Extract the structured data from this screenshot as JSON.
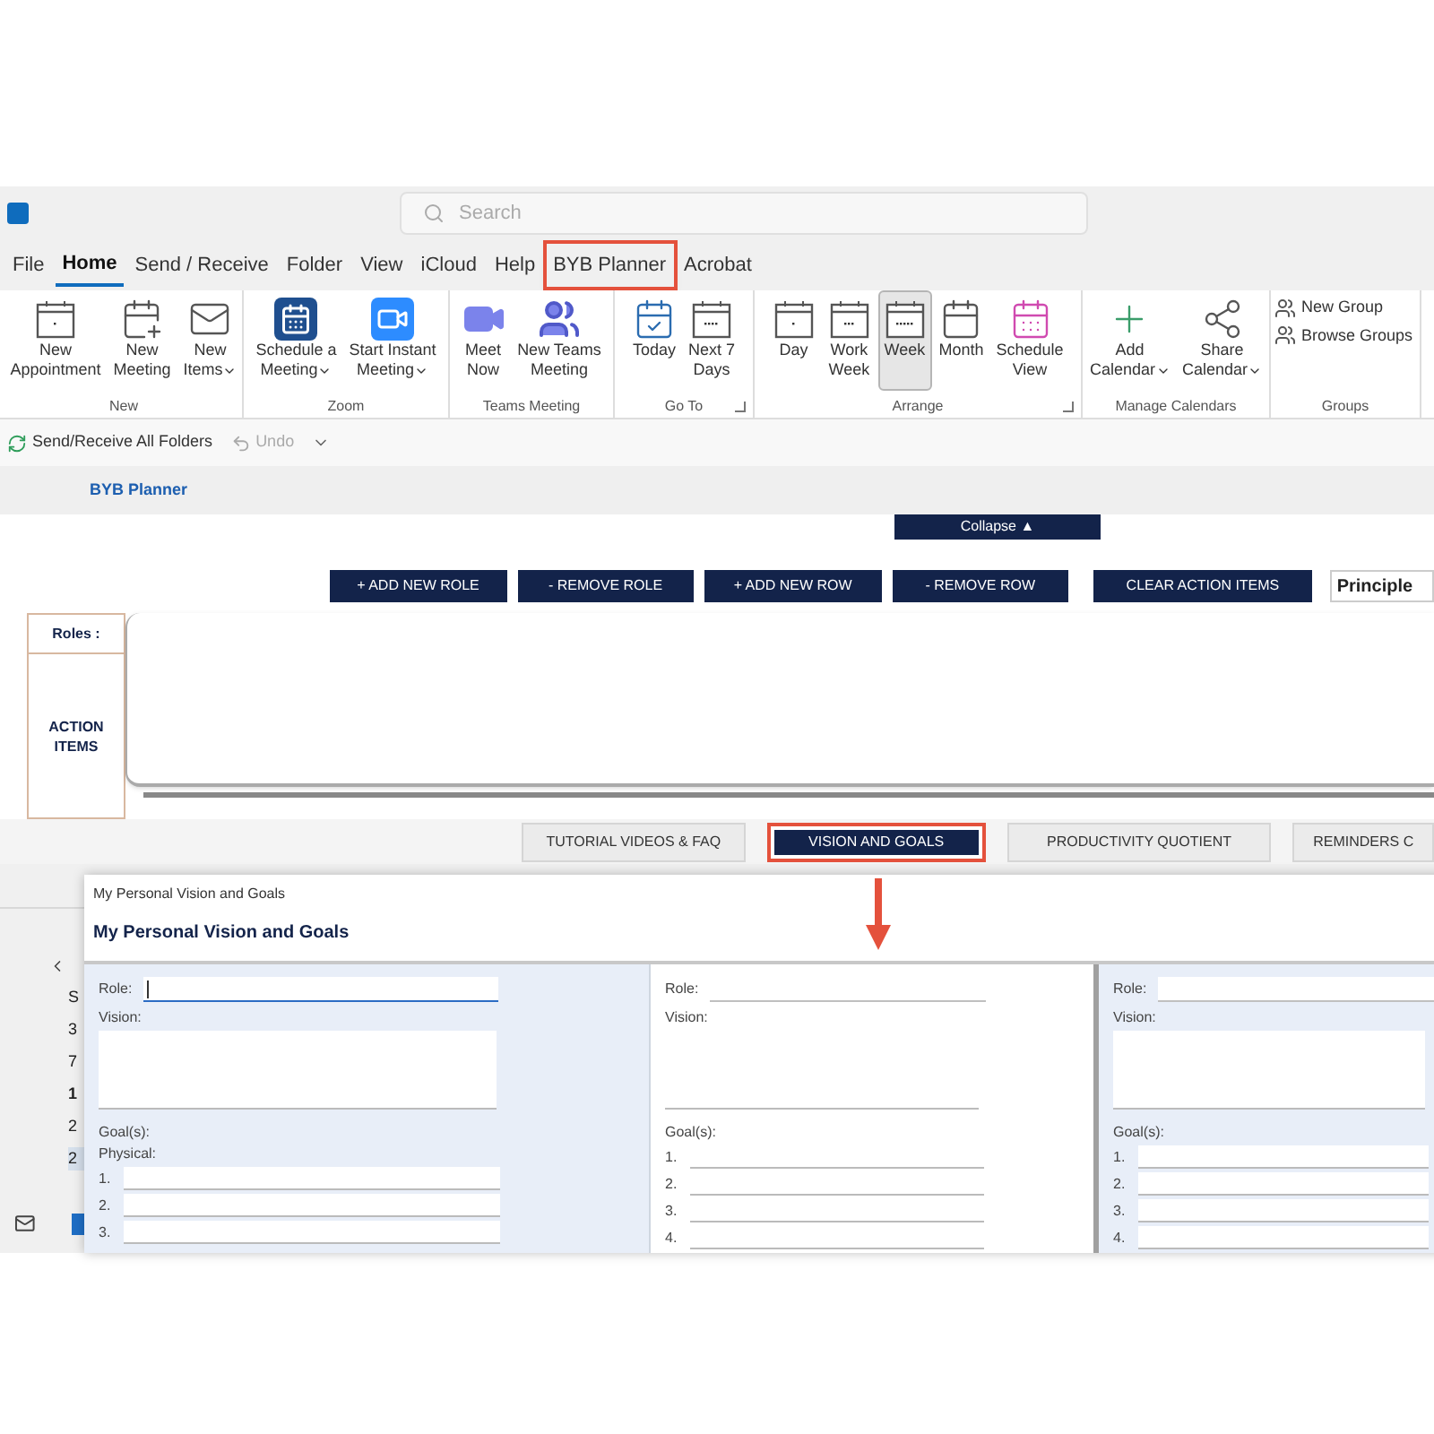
{
  "search": {
    "placeholder": "Search"
  },
  "menu_tabs": [
    {
      "label": "File",
      "selected": false,
      "highlighted": false
    },
    {
      "label": "Home",
      "selected": true,
      "highlighted": false
    },
    {
      "label": "Send / Receive",
      "selected": false,
      "highlighted": false
    },
    {
      "label": "Folder",
      "selected": false,
      "highlighted": false
    },
    {
      "label": "View",
      "selected": false,
      "highlighted": false
    },
    {
      "label": "iCloud",
      "selected": false,
      "highlighted": false
    },
    {
      "label": "Help",
      "selected": false,
      "highlighted": false
    },
    {
      "label": "BYB Planner",
      "selected": false,
      "highlighted": true
    },
    {
      "label": "Acrobat",
      "selected": false,
      "highlighted": false
    }
  ],
  "ribbon_groups": [
    {
      "label": "New",
      "launcher": false,
      "buttons": [
        {
          "kind": "large",
          "lines": [
            "New",
            "Appointment"
          ],
          "dropdown": false,
          "selected": false
        },
        {
          "kind": "large",
          "lines": [
            "New",
            "Meeting"
          ],
          "dropdown": false,
          "selected": false
        },
        {
          "kind": "large",
          "lines": [
            "New",
            "Items"
          ],
          "dropdown": true,
          "selected": false
        }
      ]
    },
    {
      "label": "Zoom",
      "launcher": false,
      "buttons": [
        {
          "kind": "large",
          "lines": [
            "Schedule a",
            "Meeting"
          ],
          "dropdown": true,
          "selected": false
        },
        {
          "kind": "large",
          "lines": [
            "Start Instant",
            "Meeting"
          ],
          "dropdown": true,
          "selected": false
        }
      ]
    },
    {
      "label": "Teams Meeting",
      "launcher": false,
      "buttons": [
        {
          "kind": "large",
          "lines": [
            "Meet",
            "Now"
          ],
          "dropdown": false,
          "selected": false
        },
        {
          "kind": "large",
          "lines": [
            "New Teams",
            "Meeting"
          ],
          "dropdown": false,
          "selected": false
        }
      ]
    },
    {
      "label": "Go To",
      "launcher": true,
      "buttons": [
        {
          "kind": "large",
          "lines": [
            "Today"
          ],
          "dropdown": false,
          "selected": false
        },
        {
          "kind": "large",
          "lines": [
            "Next 7",
            "Days"
          ],
          "dropdown": false,
          "selected": false
        }
      ]
    },
    {
      "label": "Arrange",
      "launcher": true,
      "buttons": [
        {
          "kind": "large",
          "lines": [
            "Day"
          ],
          "dropdown": false,
          "selected": false
        },
        {
          "kind": "large",
          "lines": [
            "Work",
            "Week"
          ],
          "dropdown": false,
          "selected": false
        },
        {
          "kind": "large",
          "lines": [
            "Week"
          ],
          "dropdown": false,
          "selected": true
        },
        {
          "kind": "large",
          "lines": [
            "Month"
          ],
          "dropdown": false,
          "selected": false
        },
        {
          "kind": "large",
          "lines": [
            "Schedule",
            "View"
          ],
          "dropdown": false,
          "selected": false
        }
      ]
    },
    {
      "label": "Manage Calendars",
      "launcher": false,
      "buttons": [
        {
          "kind": "large",
          "lines": [
            "Add",
            "Calendar"
          ],
          "dropdown": true,
          "selected": false
        },
        {
          "kind": "large",
          "lines": [
            "Share",
            "Calendar"
          ],
          "dropdown": true,
          "selected": false
        }
      ]
    },
    {
      "label": "Groups",
      "launcher": false,
      "buttons": [
        {
          "kind": "small",
          "lines": [
            "New Group"
          ],
          "dropdown": false,
          "selected": false
        },
        {
          "kind": "small",
          "lines": [
            "Browse Groups"
          ],
          "dropdown": false,
          "selected": false
        }
      ]
    }
  ],
  "quick_access": [
    {
      "label": "Send/Receive All Folders",
      "disabled": false
    },
    {
      "label": "Undo",
      "disabled": true
    }
  ],
  "planner": {
    "title": "BYB Planner",
    "collapse": "Collapse ▲",
    "actions": [
      "+ ADD NEW ROLE",
      "- REMOVE ROLE",
      "+ ADD NEW ROW",
      "- REMOVE ROW",
      "CLEAR ACTION ITEMS"
    ],
    "principle_field": "Principle",
    "roles_label": "Roles :",
    "action_items_label": "ACTION ITEMS",
    "tabs": [
      {
        "label": "TUTORIAL VIDEOS & FAQ",
        "selected": false,
        "highlighted": false
      },
      {
        "label": "VISION AND GOALS",
        "selected": true,
        "highlighted": true
      },
      {
        "label": "PRODUCTIVITY QUOTIENT",
        "selected": false,
        "highlighted": false
      },
      {
        "label": "REMINDERS C",
        "selected": false,
        "highlighted": false
      }
    ]
  },
  "calendar_sidebar": {
    "days": [
      {
        "label": "S",
        "today": false,
        "selected": false
      },
      {
        "label": "3",
        "today": false,
        "selected": false
      },
      {
        "label": "7",
        "today": false,
        "selected": false
      },
      {
        "label": "1",
        "today": true,
        "selected": false
      },
      {
        "label": "2",
        "today": false,
        "selected": false
      },
      {
        "label": "2",
        "today": false,
        "selected": true
      }
    ]
  },
  "dialog": {
    "title": "My Personal Vision and Goals",
    "heading": "My Personal Vision and Goals",
    "columns": [
      {
        "shaded": true,
        "focused": true,
        "role_label": "Role:",
        "vision_label": "Vision:",
        "goals_label": "Goal(s):",
        "subheading": "Physical:",
        "goal_numbers": [
          "1.",
          "2.",
          "3."
        ]
      },
      {
        "shaded": false,
        "focused": false,
        "role_label": "Role:",
        "vision_label": "Vision:",
        "goals_label": "Goal(s):",
        "goal_numbers": [
          "1.",
          "2.",
          "3.",
          "4."
        ]
      },
      {
        "shaded": true,
        "focused": false,
        "role_label": "Role:",
        "vision_label": "Vision:",
        "goals_label": "Goal(s):",
        "goal_numbers": [
          "1.",
          "2.",
          "3.",
          "4."
        ]
      }
    ]
  }
}
